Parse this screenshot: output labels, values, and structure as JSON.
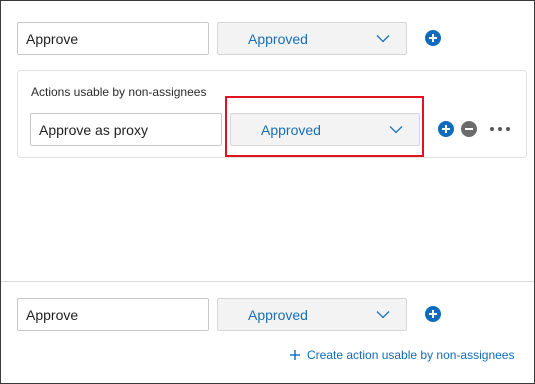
{
  "rows": [
    {
      "action": "Approve",
      "status": "Approved"
    },
    {
      "action": "Approve as proxy",
      "status": "Approved"
    },
    {
      "action": "Approve",
      "status": "Approved"
    }
  ],
  "card": {
    "label": "Actions usable by non-assignees"
  },
  "create_link": {
    "label": "Create action usable by non-assignees"
  },
  "colors": {
    "accent": "#0f6cbd",
    "highlight": "#e0141e",
    "remove": "#6b6b6b"
  },
  "icons": {
    "add": "plus-circle-icon",
    "remove": "minus-circle-icon",
    "more": "more-horizontal-icon",
    "chevron": "chevron-down-icon"
  }
}
